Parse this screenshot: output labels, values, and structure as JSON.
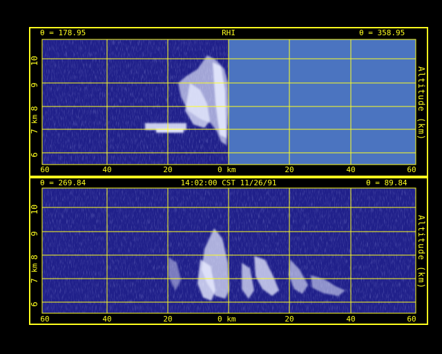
{
  "colors": {
    "background": "#000000",
    "frame": "#ffff1e",
    "radar_bg": "#20208a",
    "no_data": "#4b74c0",
    "echo": "#e8ecff"
  },
  "top_panel": {
    "theta_left": "θ = 178.95",
    "title": "RHI",
    "theta_right": "θ = 358.95",
    "left_axis_label": "km",
    "right_axis_label": "Altitude (km)",
    "y_ticks": [
      "10",
      "9",
      "8",
      "7",
      "6"
    ],
    "x_ticks": [
      "60",
      "40",
      "20",
      "0 km",
      "20",
      "40",
      "60"
    ],
    "no_data_region": "right half (0 to 60 km) shown as uniform blue"
  },
  "bottom_panel": {
    "theta_left": "θ = 269.84",
    "timestamp": "14:02:00 CST 11/26/91",
    "theta_right": "θ = 89.84",
    "left_axis_label": "km",
    "right_axis_label": "Altitude (km)",
    "y_ticks": [
      "10",
      "9",
      "8",
      "7",
      "6"
    ],
    "x_ticks": [
      "60",
      "40",
      "20",
      "0 km",
      "20",
      "40",
      "60"
    ]
  }
}
